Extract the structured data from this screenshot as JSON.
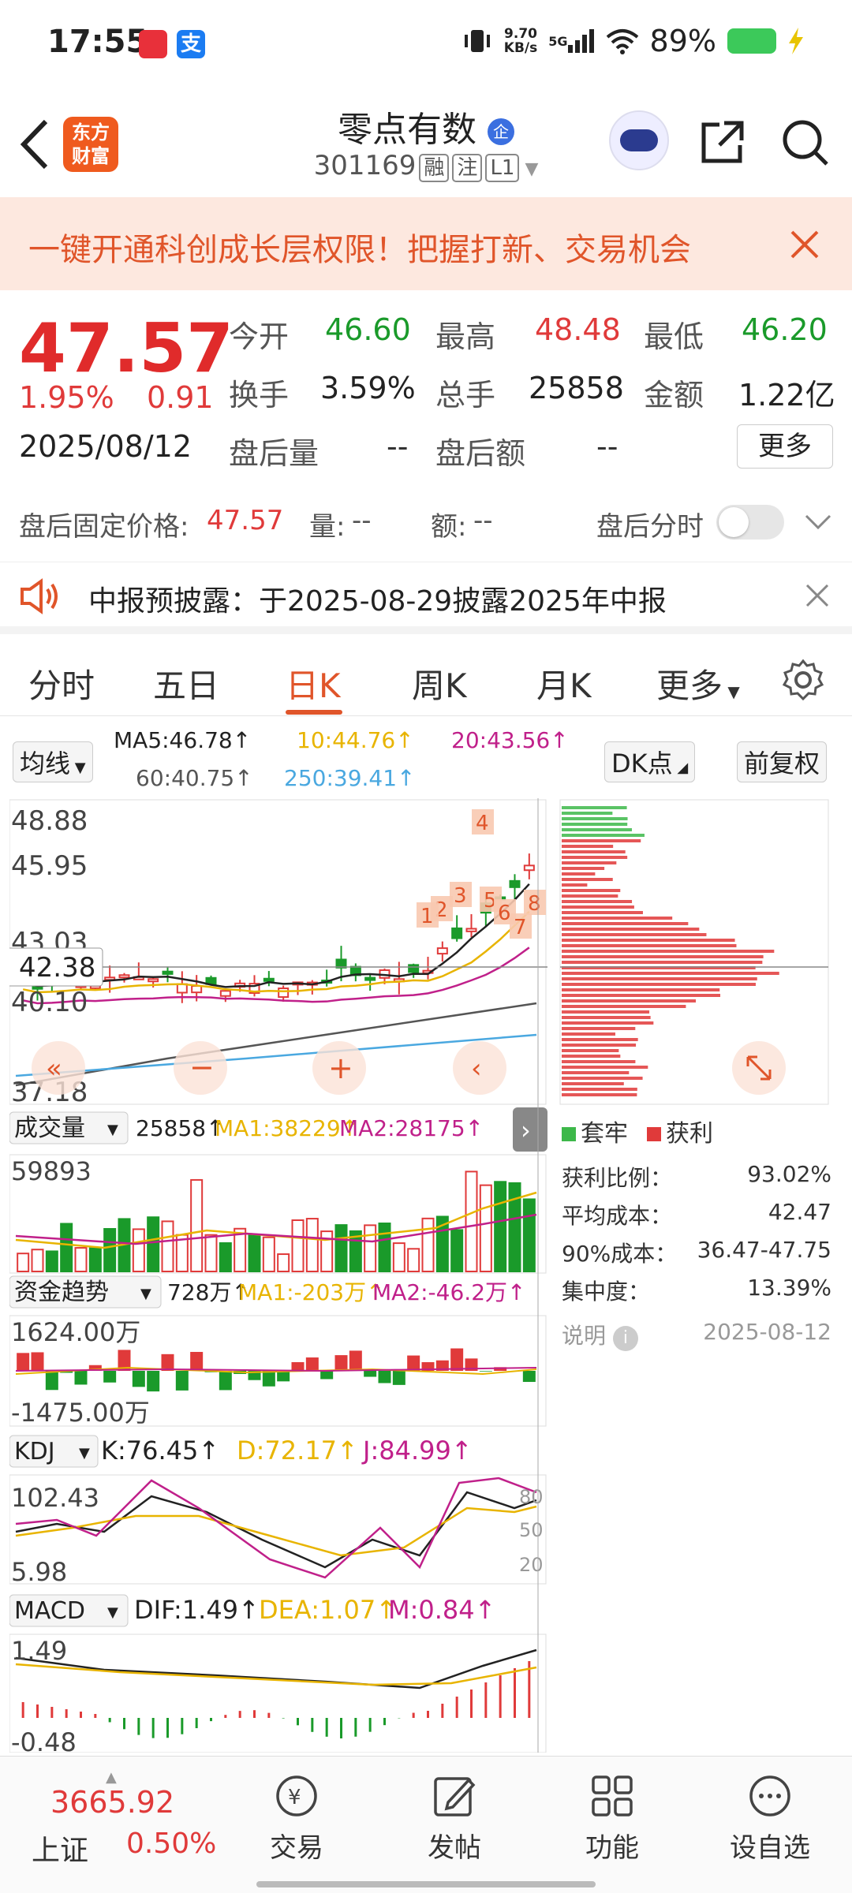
{
  "status": {
    "time": "17:55",
    "net_speed_value": "9.70",
    "net_speed_unit": "KB/s",
    "signal": "5G",
    "battery": "89%",
    "app2": "支"
  },
  "header": {
    "title": "零点有数",
    "q_badge": "企",
    "code": "301169",
    "tags": [
      "融",
      "注",
      "L1"
    ],
    "logo": [
      "东方",
      "财富"
    ]
  },
  "banner": {
    "text": "一键开通科创成长层权限！把握打新、交易机会"
  },
  "quote": {
    "price": "47.57",
    "change_pct": "1.95%",
    "change": "0.91",
    "date": "2025/08/12",
    "open_label": "今开",
    "open": "46.60",
    "high_label": "最高",
    "high": "48.48",
    "low_label": "最低",
    "low": "46.20",
    "turnover_label": "换手",
    "turnover": "3.59%",
    "volume_label": "总手",
    "volume": "25858",
    "amount_label": "金额",
    "amount": "1.22亿",
    "after_vol_label": "盘后量",
    "after_vol": "--",
    "after_amt_label": "盘后额",
    "after_amt": "--",
    "more": "更多"
  },
  "after": {
    "fixed_label": "盘后固定价格:",
    "fixed_price": "47.57",
    "vol_label": "量:",
    "vol": "--",
    "amt_label": "额:",
    "amt": "--",
    "toggle_label": "盘后分时"
  },
  "notice": {
    "text": "中报预披露：于2025-08-29披露2025年中报"
  },
  "tabs": [
    "分时",
    "五日",
    "日K",
    "周K",
    "月K",
    "更多"
  ],
  "ma": {
    "selector": "均线",
    "ma5": "MA5:46.78↑",
    "ma10": "10:44.76↑",
    "ma20": "20:43.56↑",
    "ma60": "60:40.75↑",
    "ma250": "250:39.41↑",
    "dk": "DK点",
    "fq": "前复权"
  },
  "colors": {
    "red": "#e03a3a",
    "green": "#1a9a2a",
    "ma5": "#222222",
    "ma10": "#e8b400",
    "ma20": "#c0208a",
    "ma60": "#555555",
    "ma250": "#4aa8e0",
    "accent": "#e0552a"
  },
  "kline": {
    "ylabels": [
      "48.88",
      "45.95",
      "43.03",
      "42.38",
      "40.10",
      "37.18"
    ],
    "markers": [
      "4",
      "3",
      "2",
      "1",
      "5",
      "6",
      "7",
      "8"
    ]
  },
  "vol": {
    "selector": "成交量",
    "value": "25858↑",
    "ma1": "MA1:38229↑",
    "ma2": "MA2:28175↑",
    "ymax": "59893"
  },
  "fund": {
    "selector": "资金趋势",
    "value": "728万↑",
    "ma1": "MA1:-203万↑",
    "ma2": "MA2:-46.2万↑",
    "ymax": "1624.00万",
    "ymin": "-1475.00万"
  },
  "kdj": {
    "selector": "KDJ",
    "k": "K:76.45↑",
    "d": "D:72.17↑",
    "j": "J:84.99↑",
    "ymax": "102.43",
    "ymin": "5.98",
    "levels": [
      "80",
      "50",
      "20"
    ]
  },
  "macd": {
    "selector": "MACD",
    "dif": "DIF:1.49↑",
    "dea": "DEA:1.07↑",
    "m": "M:0.84↑",
    "ymax": "1.49",
    "ymin": "-0.48"
  },
  "chips": {
    "legend_trap": "套牢",
    "legend_profit": "获利",
    "profit_ratio_label": "获利比例：",
    "profit_ratio": "93.02%",
    "avg_cost_label": "平均成本：",
    "avg_cost": "42.47",
    "cost90_label": "90%成本：",
    "cost90": "36.47-47.75",
    "concentration_label": "集中度：",
    "concentration": "13.39%",
    "note": "说明",
    "date": "2025-08-12"
  },
  "nav": {
    "index_value": "3665.92",
    "index_name": "上证",
    "index_pct": "0.50%",
    "items": [
      "交易",
      "发帖",
      "功能",
      "设自选"
    ]
  }
}
